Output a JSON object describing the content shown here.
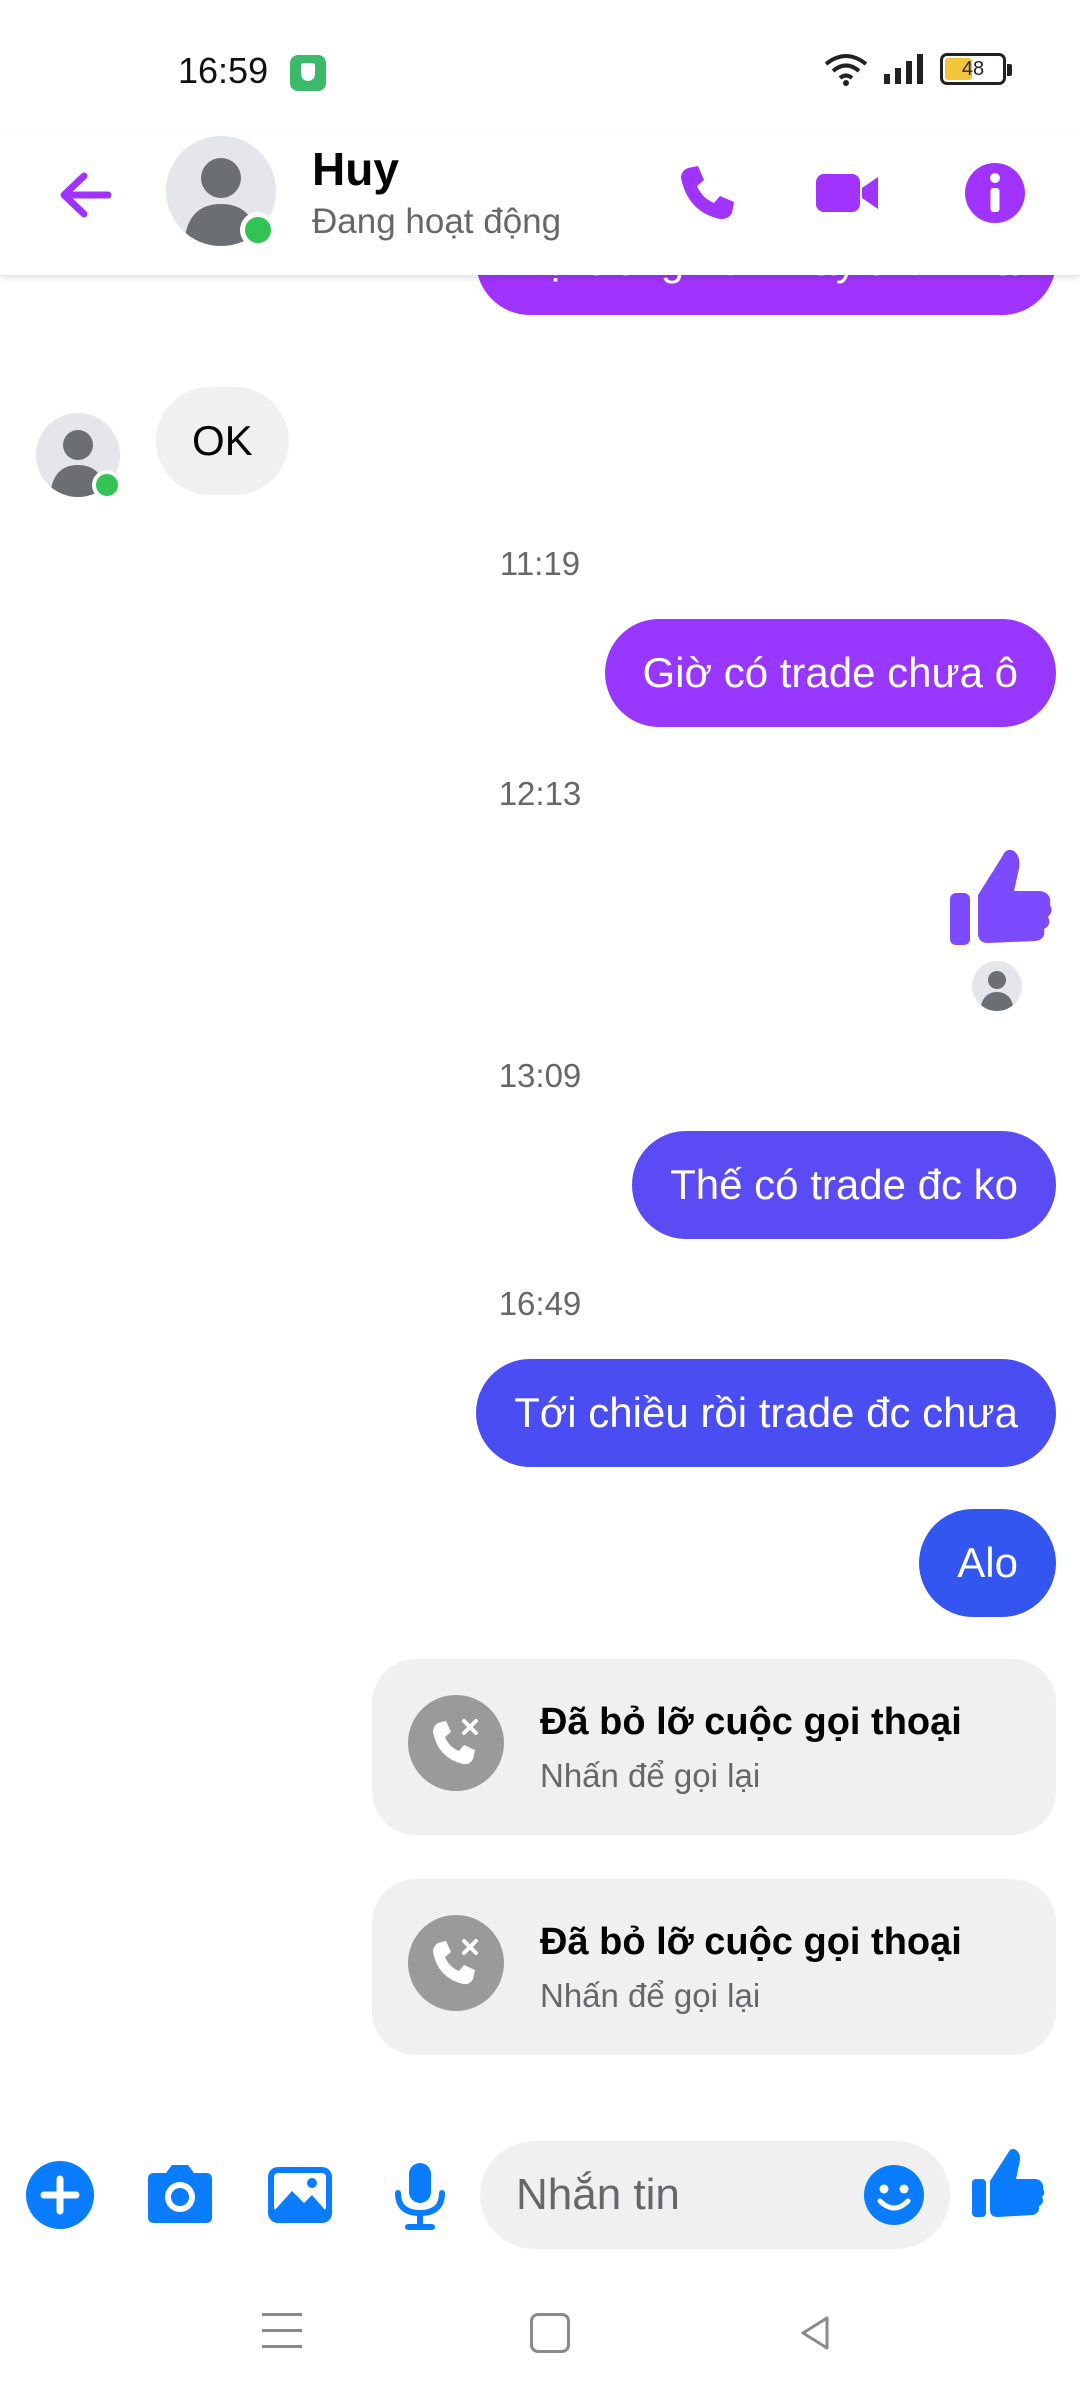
{
  "status_bar": {
    "time": "16:59",
    "battery": "48"
  },
  "header": {
    "name": "Huy",
    "status": "Đang hoạt động"
  },
  "colors": {
    "accent": "#a033ff",
    "messenger_blue": "#0a7cff",
    "online": "#31c454"
  },
  "messages": {
    "m0": "Nội trong hôm nay thôi nha",
    "m1": "OK",
    "t1": "11:19",
    "m2": "Giờ có trade chưa ô",
    "t2": "12:13",
    "t3": "13:09",
    "m3": "Thế có trade đc ko",
    "t4": "16:49",
    "m4": "Tới chiều rồi trade đc chưa",
    "m5": "Alo"
  },
  "missed_calls": [
    {
      "title": "Đã bỏ lỡ cuộc gọi thoại",
      "subtitle": "Nhấn để gọi lại"
    },
    {
      "title": "Đã bỏ lỡ cuộc gọi thoại",
      "subtitle": "Nhấn để gọi lại"
    }
  ],
  "composer": {
    "placeholder": "Nhắn tin"
  },
  "icons": [
    "back-arrow-icon",
    "phone-icon",
    "video-icon",
    "info-icon",
    "plus-icon",
    "camera-icon",
    "image-icon",
    "microphone-icon",
    "emoji-icon",
    "thumbs-up-icon",
    "missed-call-icon"
  ]
}
